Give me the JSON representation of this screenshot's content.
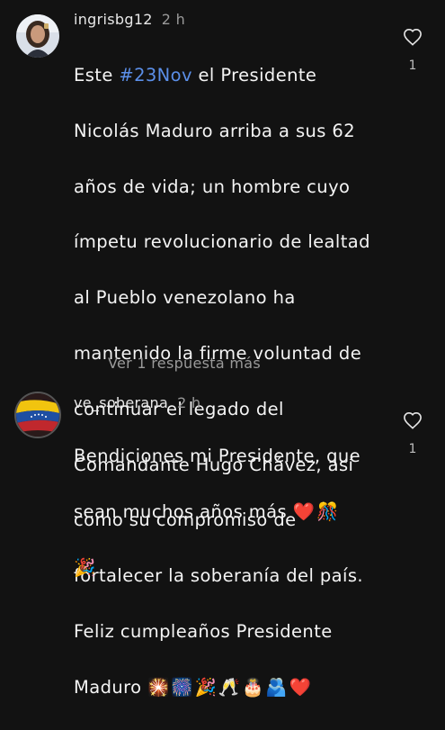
{
  "comments": [
    {
      "username": "ingrisbg12",
      "time": "2 h",
      "lines": [
        "Nicolás Maduro arriba a sus 62",
        "años de vida; un hombre cuyo",
        "ímpetu revolucionario de lealtad",
        "al Pueblo venezolano ha",
        "mantenido la firme voluntad de",
        "continuar el legado del",
        "Comandante Hugo Chávez, así",
        "como su compromiso de",
        "fortalecer la soberanía del país.",
        "Feliz cumpleaños Presidente"
      ],
      "first_line_prefix": "Este ",
      "hashtag": "#23Nov",
      "first_line_suffix": " el Presidente",
      "last_line_text": "Maduro ",
      "last_line_emojis": "🎇🎆🎉🥂🎂🫂❤️",
      "replies_link": "Ver 1 respuesta más",
      "likes": "1",
      "like_icon": "heart-outline-icon"
    },
    {
      "username": "ve_soberana",
      "time": "2 h",
      "line1": "Bendiciones mi Presidente, que",
      "line2_text": "sean muchos años más ",
      "line2_emojis": "❤️🎊",
      "line3_emojis": "🎉",
      "likes": "1",
      "like_icon": "heart-outline-icon"
    }
  ],
  "colors": {
    "background": "#121212",
    "hashtag": "#5b8fe8",
    "muted": "#9a9a9a"
  }
}
